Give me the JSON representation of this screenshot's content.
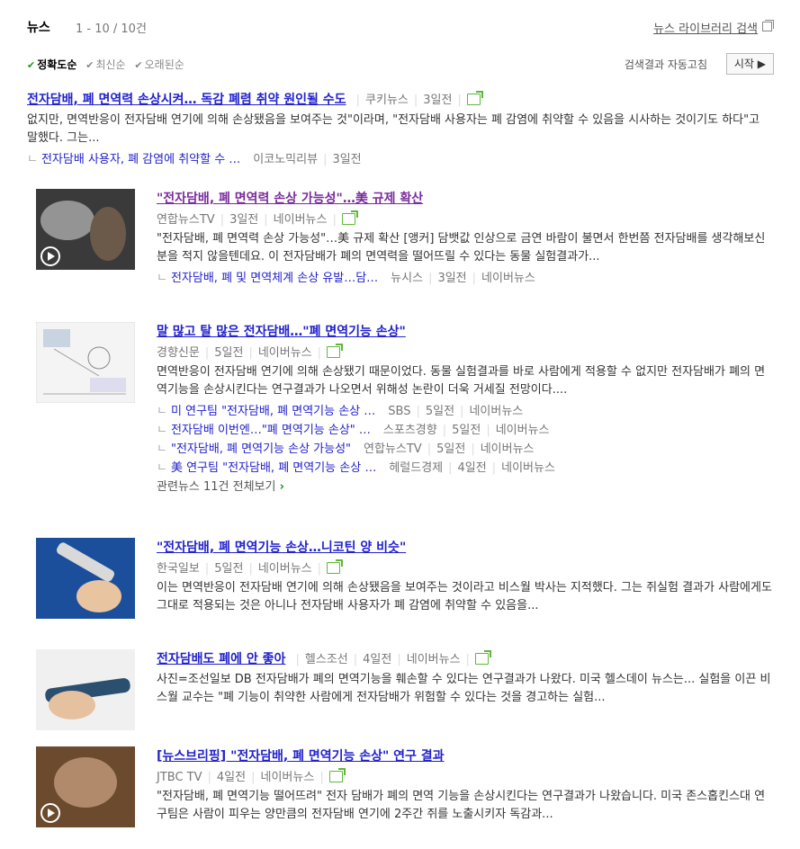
{
  "header": {
    "title": "뉴스",
    "count": "1 - 10 / 10건",
    "library_link": "뉴스 라이브러리 검색"
  },
  "sort": {
    "options": [
      "정확도순",
      "최신순",
      "오래된순"
    ],
    "auto_label": "검색결과 자동고침",
    "start_button": "시작 ▶"
  },
  "share_label": "네이버뉴스",
  "items": [
    {
      "title": "전자담배, 폐 면역력 손상시켜… 독감 폐렴 취약 원인될 수도",
      "source": "쿠키뉴스",
      "date": "3일전",
      "desc": "없지만, 면역반응이 전자담배 연기에 의해 손상됐음을 보여주는 것\"이라며, \"전자담배 사용자는 폐 감염에 취약할 수 있음을 시사하는 것이기도 하다\"고 말했다. 그는...",
      "subs": [
        {
          "title": "전자담배 사용자, 폐 감염에 취약할 수 …",
          "source": "이코노믹리뷰",
          "date": "3일전"
        }
      ]
    },
    {
      "title": "\"전자담배, 폐 면역력 손상 가능성\"…美 규제 확산",
      "source": "연합뉴스TV",
      "date": "3일전",
      "naver": "네이버뉴스",
      "desc": "\"전자담배, 폐 면역력 손상 가능성\"…美 규제 확산 [앵커] 담뱃값 인상으로 금연 바람이 불면서 한번쯤 전자담배를 생각해보신 분을 적지 않을텐데요. 이 전자담배가 폐의 면역력을 떨어뜨릴 수 있다는 동물 실험결과가...",
      "subs": [
        {
          "title": "전자담배, 폐 및 면역체계 손상 유발…담…",
          "source": "뉴시스",
          "date": "3일전",
          "naver": "네이버뉴스"
        }
      ]
    },
    {
      "title": "말 많고 탈 많은 전자담배…\"폐 면역기능 손상\"",
      "source": "경향신문",
      "date": "5일전",
      "naver": "네이버뉴스",
      "desc": "면역반응이 전자담배 연기에 의해 손상됐기 때문이었다. 동물 실험결과를 바로 사람에게 적용할 수 없지만 전자담배가 폐의 면역기능을 손상시킨다는 연구결과가 나오면서 위해성 논란이 더욱 거세질 전망이다....",
      "subs": [
        {
          "title": "미 연구팀 \"전자담배, 폐 면역기능 손상 …",
          "source": "SBS",
          "date": "5일전",
          "naver": "네이버뉴스"
        },
        {
          "title": "전자담배 이번엔…\"폐 면역기능 손상\" …",
          "source": "스포츠경향",
          "date": "5일전",
          "naver": "네이버뉴스"
        },
        {
          "title": "\"전자담배, 폐 면역기능 손상 가능성\"",
          "source": "연합뉴스TV",
          "date": "5일전",
          "naver": "네이버뉴스"
        },
        {
          "title": "美 연구팀 \"전자담배, 폐 면역기능 손상 …",
          "source": "헤럴드경제",
          "date": "4일전",
          "naver": "네이버뉴스"
        }
      ],
      "more": "관련뉴스 11건 전체보기"
    },
    {
      "title": "\"전자담배, 폐 면역기능 손상…니코틴 양 비슷\"",
      "source": "한국일보",
      "date": "5일전",
      "naver": "네이버뉴스",
      "desc": "이는 면역반응이 전자담배 연기에 의해 손상됐음을 보여주는 것이라고 비스월 박사는 지적했다. 그는 쥐실험 결과가 사람에게도 그대로 적용되는 것은 아니나 전자담배 사용자가 폐 감염에 취약할 수 있음을..."
    },
    {
      "title": "전자담배도 폐에 안 좋아",
      "source": "헬스조선",
      "date": "4일전",
      "naver": "네이버뉴스",
      "desc": "사진=조선일보 DB 전자담배가 폐의 면역기능을 훼손할 수 있다는 연구결과가 나왔다. 미국 헬스데이 뉴스는... 실험을 이끈 비스월 교수는 \"폐 기능이 취약한 사람에게 전자담배가 위험할 수 있다는 것을 경고하는 실험..."
    },
    {
      "title": "[뉴스브리핑] \"전자담배, 폐 면역기능 손상\" 연구 결과",
      "source": "JTBC TV",
      "date": "4일전",
      "naver": "네이버뉴스",
      "desc": "\"전자담배, 폐 면역기능 떨어뜨려\" 전자 담배가 폐의 면역 기능을 손상시킨다는 연구결과가 나왔습니다. 미국 존스홉킨스대 연구팀은 사람이 피우는 양만큼의 전자담배 연기에 2주간 쥐를 노출시키자 독감과..."
    }
  ]
}
